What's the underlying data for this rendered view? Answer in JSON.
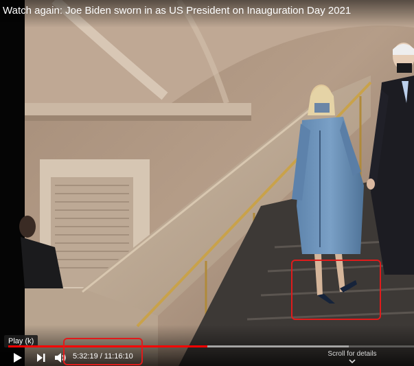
{
  "player": {
    "title": "Watch again: Joe Biden sworn in as US President on Inauguration Day 2021",
    "tooltip": "Play (k)",
    "current_time": "5:32:19",
    "separator": "/",
    "duration": "11:16:10",
    "progress_fraction": 0.491,
    "buffered_fraction": 0.84,
    "scroll_hint": "Scroll for details",
    "accent_color": "#ff0000",
    "highlight_color": "#e01b1b"
  },
  "icons": {
    "play": "play-icon",
    "next": "next-icon",
    "volume": "volume-icon",
    "chevron": "chevron-down-icon"
  }
}
